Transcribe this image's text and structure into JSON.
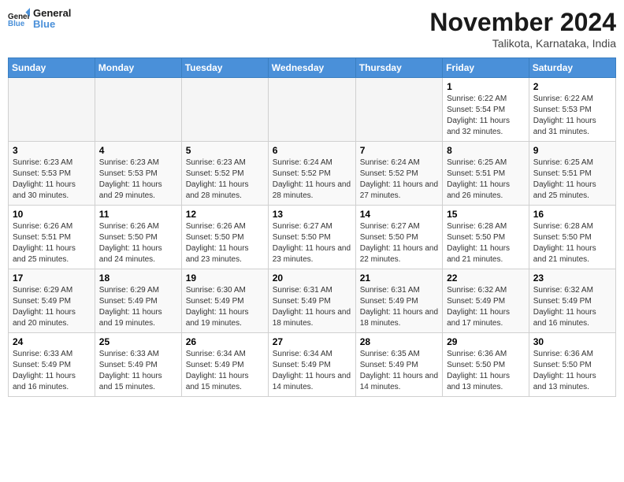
{
  "logo": {
    "text_general": "General",
    "text_blue": "Blue"
  },
  "title": "November 2024",
  "location": "Talikota, Karnataka, India",
  "weekdays": [
    "Sunday",
    "Monday",
    "Tuesday",
    "Wednesday",
    "Thursday",
    "Friday",
    "Saturday"
  ],
  "weeks": [
    [
      {
        "day": "",
        "info": "",
        "empty": true
      },
      {
        "day": "",
        "info": "",
        "empty": true
      },
      {
        "day": "",
        "info": "",
        "empty": true
      },
      {
        "day": "",
        "info": "",
        "empty": true
      },
      {
        "day": "",
        "info": "",
        "empty": true
      },
      {
        "day": "1",
        "info": "Sunrise: 6:22 AM\nSunset: 5:54 PM\nDaylight: 11 hours and 32 minutes."
      },
      {
        "day": "2",
        "info": "Sunrise: 6:22 AM\nSunset: 5:53 PM\nDaylight: 11 hours and 31 minutes."
      }
    ],
    [
      {
        "day": "3",
        "info": "Sunrise: 6:23 AM\nSunset: 5:53 PM\nDaylight: 11 hours and 30 minutes."
      },
      {
        "day": "4",
        "info": "Sunrise: 6:23 AM\nSunset: 5:53 PM\nDaylight: 11 hours and 29 minutes."
      },
      {
        "day": "5",
        "info": "Sunrise: 6:23 AM\nSunset: 5:52 PM\nDaylight: 11 hours and 28 minutes."
      },
      {
        "day": "6",
        "info": "Sunrise: 6:24 AM\nSunset: 5:52 PM\nDaylight: 11 hours and 28 minutes."
      },
      {
        "day": "7",
        "info": "Sunrise: 6:24 AM\nSunset: 5:52 PM\nDaylight: 11 hours and 27 minutes."
      },
      {
        "day": "8",
        "info": "Sunrise: 6:25 AM\nSunset: 5:51 PM\nDaylight: 11 hours and 26 minutes."
      },
      {
        "day": "9",
        "info": "Sunrise: 6:25 AM\nSunset: 5:51 PM\nDaylight: 11 hours and 25 minutes."
      }
    ],
    [
      {
        "day": "10",
        "info": "Sunrise: 6:26 AM\nSunset: 5:51 PM\nDaylight: 11 hours and 25 minutes."
      },
      {
        "day": "11",
        "info": "Sunrise: 6:26 AM\nSunset: 5:50 PM\nDaylight: 11 hours and 24 minutes."
      },
      {
        "day": "12",
        "info": "Sunrise: 6:26 AM\nSunset: 5:50 PM\nDaylight: 11 hours and 23 minutes."
      },
      {
        "day": "13",
        "info": "Sunrise: 6:27 AM\nSunset: 5:50 PM\nDaylight: 11 hours and 23 minutes."
      },
      {
        "day": "14",
        "info": "Sunrise: 6:27 AM\nSunset: 5:50 PM\nDaylight: 11 hours and 22 minutes."
      },
      {
        "day": "15",
        "info": "Sunrise: 6:28 AM\nSunset: 5:50 PM\nDaylight: 11 hours and 21 minutes."
      },
      {
        "day": "16",
        "info": "Sunrise: 6:28 AM\nSunset: 5:50 PM\nDaylight: 11 hours and 21 minutes."
      }
    ],
    [
      {
        "day": "17",
        "info": "Sunrise: 6:29 AM\nSunset: 5:49 PM\nDaylight: 11 hours and 20 minutes."
      },
      {
        "day": "18",
        "info": "Sunrise: 6:29 AM\nSunset: 5:49 PM\nDaylight: 11 hours and 19 minutes."
      },
      {
        "day": "19",
        "info": "Sunrise: 6:30 AM\nSunset: 5:49 PM\nDaylight: 11 hours and 19 minutes."
      },
      {
        "day": "20",
        "info": "Sunrise: 6:31 AM\nSunset: 5:49 PM\nDaylight: 11 hours and 18 minutes."
      },
      {
        "day": "21",
        "info": "Sunrise: 6:31 AM\nSunset: 5:49 PM\nDaylight: 11 hours and 18 minutes."
      },
      {
        "day": "22",
        "info": "Sunrise: 6:32 AM\nSunset: 5:49 PM\nDaylight: 11 hours and 17 minutes."
      },
      {
        "day": "23",
        "info": "Sunrise: 6:32 AM\nSunset: 5:49 PM\nDaylight: 11 hours and 16 minutes."
      }
    ],
    [
      {
        "day": "24",
        "info": "Sunrise: 6:33 AM\nSunset: 5:49 PM\nDaylight: 11 hours and 16 minutes."
      },
      {
        "day": "25",
        "info": "Sunrise: 6:33 AM\nSunset: 5:49 PM\nDaylight: 11 hours and 15 minutes."
      },
      {
        "day": "26",
        "info": "Sunrise: 6:34 AM\nSunset: 5:49 PM\nDaylight: 11 hours and 15 minutes."
      },
      {
        "day": "27",
        "info": "Sunrise: 6:34 AM\nSunset: 5:49 PM\nDaylight: 11 hours and 14 minutes."
      },
      {
        "day": "28",
        "info": "Sunrise: 6:35 AM\nSunset: 5:49 PM\nDaylight: 11 hours and 14 minutes."
      },
      {
        "day": "29",
        "info": "Sunrise: 6:36 AM\nSunset: 5:50 PM\nDaylight: 11 hours and 13 minutes."
      },
      {
        "day": "30",
        "info": "Sunrise: 6:36 AM\nSunset: 5:50 PM\nDaylight: 11 hours and 13 minutes."
      }
    ]
  ]
}
